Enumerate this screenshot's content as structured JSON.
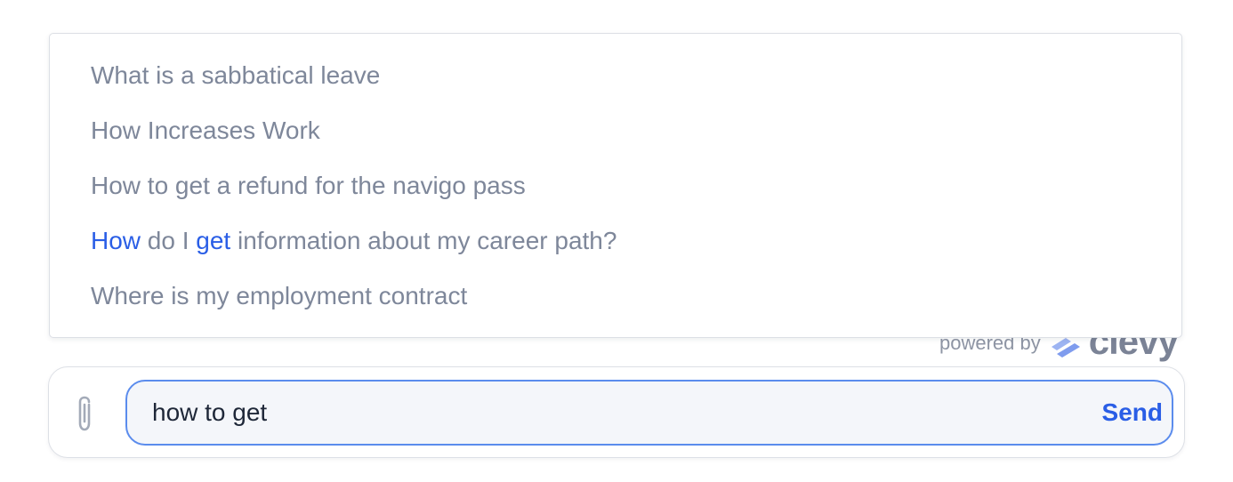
{
  "suggestions": [
    {
      "text": "What is a sabbatical leave"
    },
    {
      "text": "How Increases Work"
    },
    {
      "text": "How to get a refund for the navigo pass"
    },
    {
      "parts": [
        "How",
        " do I ",
        "get",
        " information about my career path?"
      ]
    },
    {
      "text": "Where is my employment contract"
    }
  ],
  "branding": {
    "powered_by": "powered by",
    "brand_name": "clevy",
    "logo_color": "#8fa8f0"
  },
  "composer": {
    "attach_icon": "paperclip-icon",
    "input_value": "how to get",
    "send_label": "Send"
  },
  "colors": {
    "accent": "#2a5ee6",
    "suggestion_text": "#7e879a",
    "input_border": "#5b8ced"
  }
}
